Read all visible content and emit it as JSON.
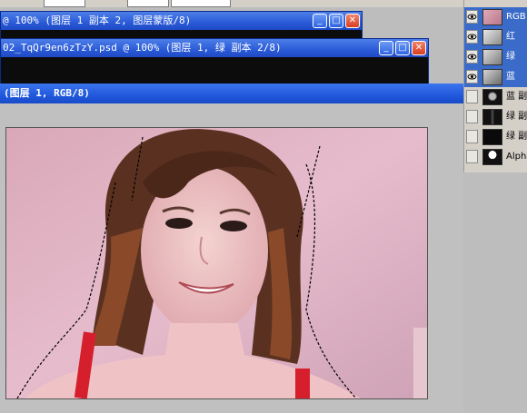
{
  "windows": [
    {
      "title": "@ 100% (图层 1 副本 2, 图层蒙版/8)",
      "min": "_",
      "max": "□",
      "close": "✕"
    },
    {
      "title": "02_TqQr9en6zTzY.psd @ 100% (图层 1, 绿 副本 2/8)",
      "min": "_",
      "max": "□",
      "close": "✕"
    }
  ],
  "document": {
    "title": "(图层 1, RGB/8)"
  },
  "channels": [
    {
      "label": "RGB",
      "visible": true,
      "selected": true,
      "thumb": "photo"
    },
    {
      "label": "红",
      "visible": true,
      "selected": true,
      "thumb": "photo-gray"
    },
    {
      "label": "绿",
      "visible": true,
      "selected": true,
      "thumb": "photo-gray"
    },
    {
      "label": "蓝",
      "visible": true,
      "selected": true,
      "thumb": "photo-gray"
    },
    {
      "label": "蓝 副",
      "visible": false,
      "selected": false,
      "thumb": "mask-dark"
    },
    {
      "label": "绿 副",
      "visible": false,
      "selected": false,
      "thumb": "mask-dark"
    },
    {
      "label": "绿 副",
      "visible": false,
      "selected": false,
      "thumb": "mask-dark"
    },
    {
      "label": "Alpha",
      "visible": false,
      "selected": false,
      "thumb": "mask-silhouette"
    }
  ],
  "icons": {
    "eye": "eye-icon"
  }
}
